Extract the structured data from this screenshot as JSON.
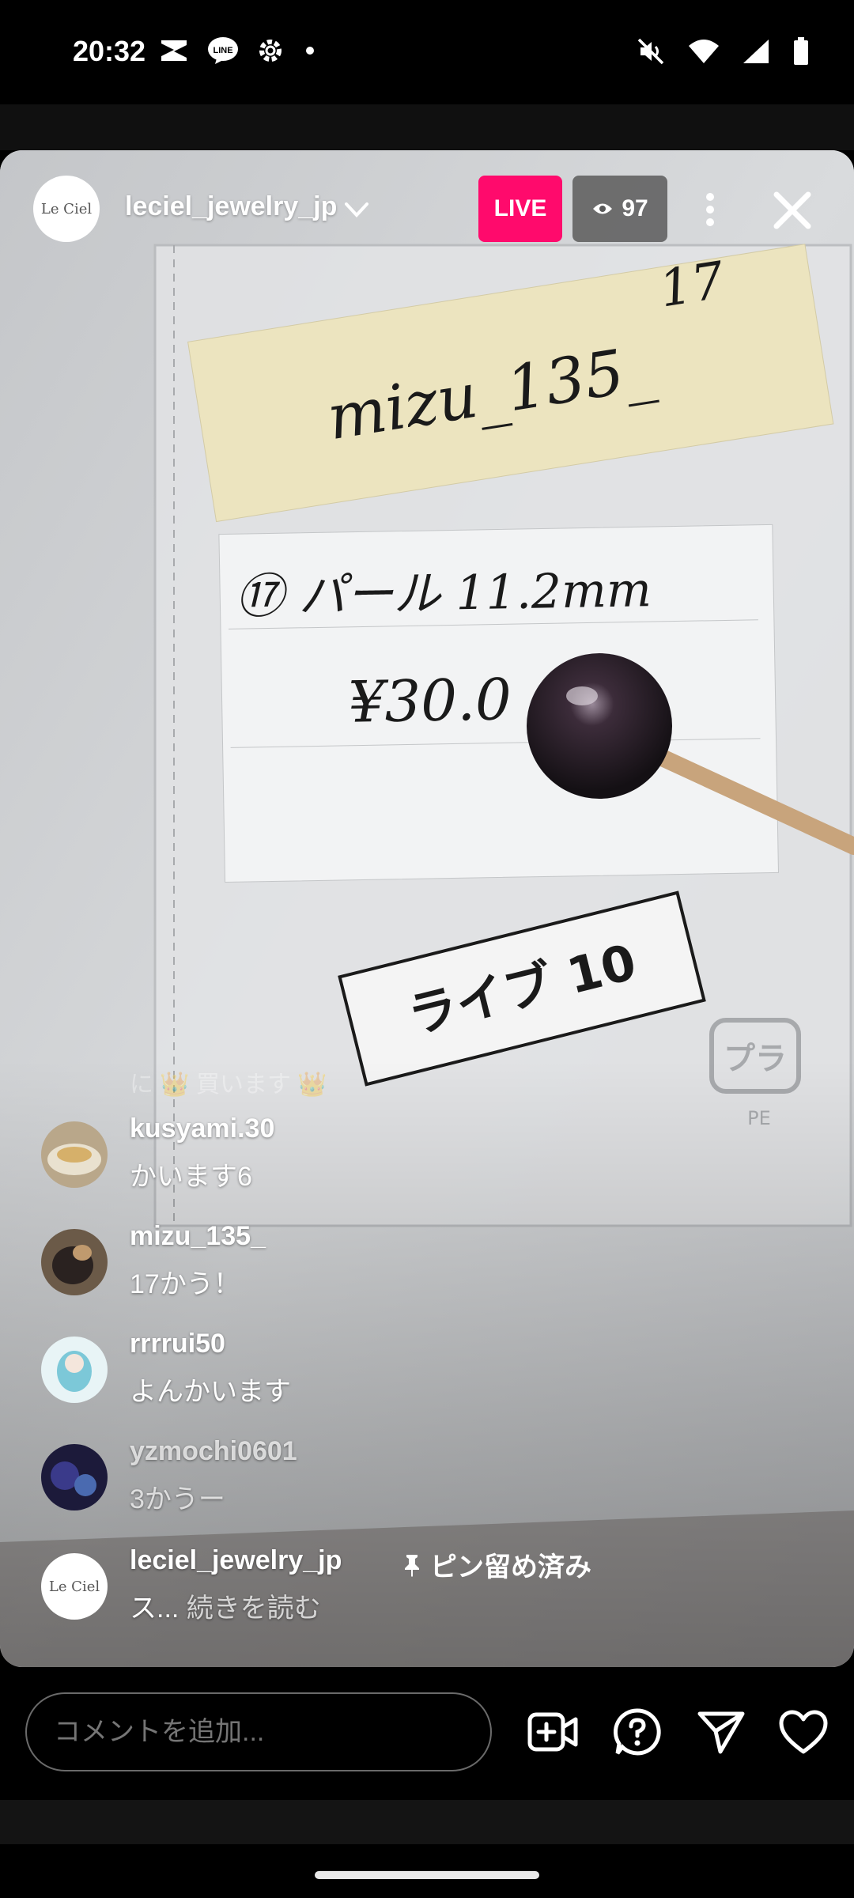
{
  "status_bar": {
    "time": "20:32",
    "left_icons": [
      "capcut-icon",
      "line-icon",
      "gear-icon",
      "dot-icon"
    ],
    "right_icons": [
      "mute-icon",
      "wifi-icon",
      "signal-icon",
      "battery-icon"
    ]
  },
  "live": {
    "username": "leciel_jewelry_jp",
    "avatar_text": "Le Ciel",
    "live_label": "LIVE",
    "viewer_count": "97"
  },
  "video_scene": {
    "sticky_note": "mizu_135_",
    "sticky_number": "17",
    "card_line1": "⑰ パール 11.2mm",
    "card_line2": "¥30.0",
    "tag_label": "ライブ 10",
    "recycle_mark": "プラ",
    "recycle_sub": "PE"
  },
  "comments": {
    "faded_text": "に 👑 買います 👑",
    "items": [
      {
        "user": "kusyami.30",
        "text": "かいます6"
      },
      {
        "user": "mizu_135_",
        "text": "17かう！"
      },
      {
        "user": "rrrrui50",
        "text": "よんかいます"
      },
      {
        "user": "yzmochi0601",
        "text": "3かうー"
      }
    ],
    "pinned": {
      "user": "leciel_jewelry_jp",
      "pin_label": "ピン留め済み",
      "text": "ス...",
      "read_more": "続きを読む"
    }
  },
  "bottom_bar": {
    "comment_placeholder": "コメントを追加...",
    "icons": [
      "add-video-icon",
      "question-icon",
      "send-icon",
      "heart-icon"
    ]
  },
  "colors": {
    "live_badge": "#ff0a6c",
    "background": "#000000"
  }
}
